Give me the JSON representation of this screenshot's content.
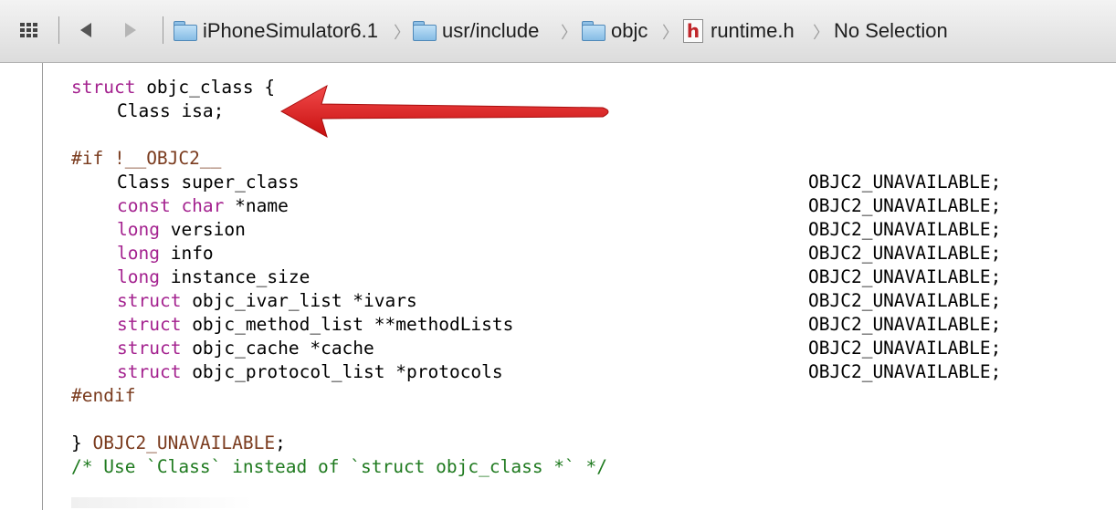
{
  "jumpbar": {
    "grid_icon": "related-items-grid-icon",
    "back_icon": "back-triangle-icon",
    "forward_icon": "forward-triangle-icon",
    "crumbs": [
      {
        "label": "iPhoneSimulator6.1",
        "icon": "folder-icon"
      },
      {
        "label": "usr/include",
        "icon": "folder-icon"
      },
      {
        "label": "objc",
        "icon": "folder-icon"
      },
      {
        "label": "runtime.h",
        "icon": "header-file-icon",
        "icon_glyph": "h"
      },
      {
        "label": "No Selection"
      }
    ],
    "chevron_glyph": "〉"
  },
  "code": {
    "l1_kw": "struct",
    "l1_rest": " objc_class {",
    "l2": "Class isa;",
    "l4_if": "#if ",
    "l4_macro": "!__OBJC2__",
    "members": [
      {
        "kw": "",
        "text": "Class super_class",
        "attr": "OBJC2_UNAVAILABLE;"
      },
      {
        "kw": "const char",
        "text": " *name",
        "attr": "OBJC2_UNAVAILABLE;"
      },
      {
        "kw": "long",
        "text": " version",
        "attr": "OBJC2_UNAVAILABLE;"
      },
      {
        "kw": "long",
        "text": " info",
        "attr": "OBJC2_UNAVAILABLE;"
      },
      {
        "kw": "long",
        "text": " instance_size",
        "attr": "OBJC2_UNAVAILABLE;"
      },
      {
        "kw": "struct",
        "text": " objc_ivar_list *ivars",
        "attr": "OBJC2_UNAVAILABLE;"
      },
      {
        "kw": "struct",
        "text": " objc_method_list **methodLists",
        "attr": "OBJC2_UNAVAILABLE;"
      },
      {
        "kw": "struct",
        "text": " objc_cache *cache",
        "attr": "OBJC2_UNAVAILABLE;"
      },
      {
        "kw": "struct",
        "text": " objc_protocol_list *protocols",
        "attr": "OBJC2_UNAVAILABLE;"
      }
    ],
    "endif": "#endif",
    "close_brace": "} ",
    "close_macro": "OBJC2_UNAVAILABLE",
    "close_semicolon": ";",
    "comment": "/* Use `Class` instead of `struct objc_class *` */"
  },
  "annotation": {
    "arrow_icon": "red-arrow-pointing-left-icon",
    "arrow_color": "#e01b1b"
  },
  "colors": {
    "keyword": "#a4228f",
    "preprocessor": "#7a3b1e",
    "comment": "#1f7a1f"
  }
}
